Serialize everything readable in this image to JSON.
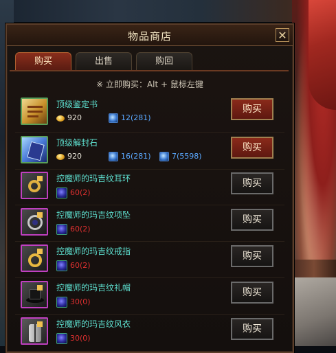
{
  "window": {
    "title": "物品商店",
    "close_label": "✕"
  },
  "tabs": [
    {
      "label": "购买",
      "active": true
    },
    {
      "label": "出售",
      "active": false
    },
    {
      "label": "购回",
      "active": false
    }
  ],
  "hint": "※ 立即购买：Alt + 鼠标左键",
  "colors": {
    "item_name": "#5ee0d0",
    "gem_count": "#5aa8ff",
    "insufficient": "#e03030",
    "accent": "#8a2e1c"
  },
  "items": [
    {
      "name": "顶级鉴定书",
      "icon": "scroll-icon",
      "gold": "920",
      "gem1": "12(281)",
      "gem2": null,
      "orb": null,
      "buy": "购买"
    },
    {
      "name": "顶级解封石",
      "icon": "unseal-stone-icon",
      "gold": "920",
      "gem1": "16(281)",
      "gem2": "7(5598)",
      "orb": null,
      "buy": "购买"
    },
    {
      "name": "控魔师的玛吉纹耳环",
      "icon": "earring-icon",
      "gold": null,
      "gem1": null,
      "gem2": null,
      "orb": "60(2)",
      "buy": "购买"
    },
    {
      "name": "控魔师的玛吉纹项坠",
      "icon": "pendant-icon",
      "gold": null,
      "gem1": null,
      "gem2": null,
      "orb": "60(2)",
      "buy": "购买"
    },
    {
      "name": "控魔师的玛吉纹戒指",
      "icon": "ring-icon",
      "gold": null,
      "gem1": null,
      "gem2": null,
      "orb": "60(2)",
      "buy": "购买"
    },
    {
      "name": "控魔师的玛吉纹礼帽",
      "icon": "top-hat-icon",
      "gold": null,
      "gem1": null,
      "gem2": null,
      "orb": "30(0)",
      "buy": "购买"
    },
    {
      "name": "控魔师的玛吉纹风衣",
      "icon": "coat-icon",
      "gold": null,
      "gem1": null,
      "gem2": null,
      "orb": "30(0)",
      "buy": "购买"
    }
  ]
}
